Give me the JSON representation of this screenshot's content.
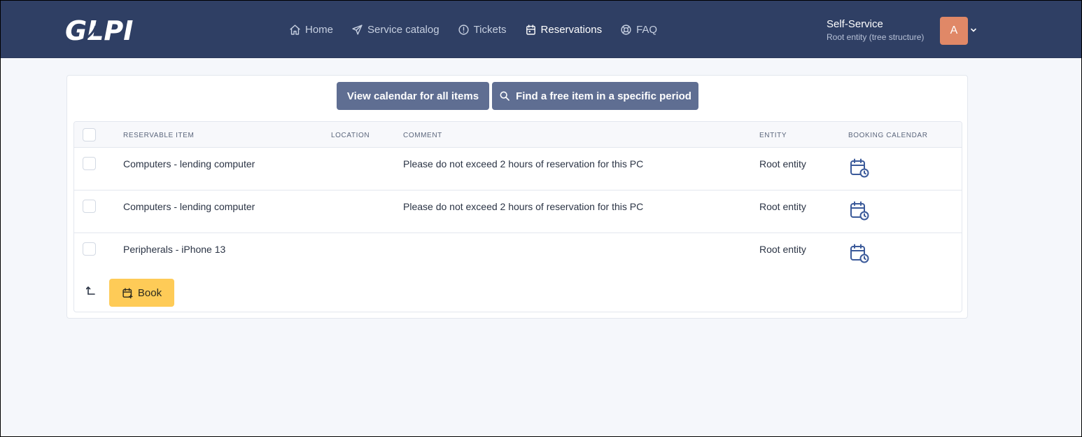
{
  "header": {
    "logo_text": "GLPI",
    "nav": [
      {
        "label": "Home",
        "icon": "home-icon"
      },
      {
        "label": "Service catalog",
        "icon": "paper-plane-icon"
      },
      {
        "label": "Tickets",
        "icon": "alert-circle-icon"
      },
      {
        "label": "Reservations",
        "icon": "calendar-icon"
      },
      {
        "label": "FAQ",
        "icon": "lifebuoy-icon"
      }
    ],
    "user": {
      "profile": "Self-Service",
      "entity": "Root entity (tree structure)",
      "avatar_initial": "A"
    }
  },
  "actions": {
    "view_calendar": "View calendar for all items",
    "find_free": "Find a free item in a specific period"
  },
  "table": {
    "columns": [
      "Reservable item",
      "Location",
      "Comment",
      "Entity",
      "Booking calendar"
    ],
    "rows": [
      {
        "item": "Computers - lending computer",
        "location": "",
        "comment": "Please do not exceed 2 hours of reservation for this PC",
        "entity": "Root entity"
      },
      {
        "item": "Computers - lending computer",
        "location": "",
        "comment": "Please do not exceed 2 hours of reservation for this PC",
        "entity": "Root entity"
      },
      {
        "item": "Peripherals - iPhone 13",
        "location": "",
        "comment": "",
        "entity": "Root entity"
      }
    ]
  },
  "footer": {
    "book_label": "Book"
  },
  "colors": {
    "topbar": "#2f3f64",
    "action_button": "#5f6e92",
    "book_button": "#fecb57",
    "calendar_icon": "#3b5a9a",
    "avatar": "#e08867"
  }
}
